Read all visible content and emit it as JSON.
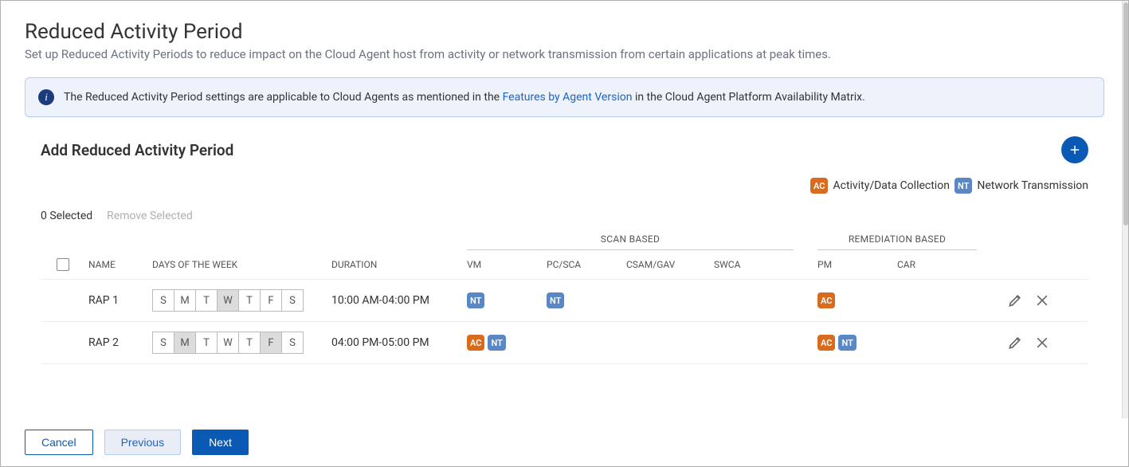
{
  "header": {
    "title": "Reduced Activity Period",
    "subtitle": "Set up Reduced Activity Periods to reduce impact on the Cloud Agent host from activity or network transmission from certain applications at peak times."
  },
  "banner": {
    "prefix": "The Reduced Activity Period settings are applicable to Cloud Agents as mentioned in the ",
    "link": "Features by Agent Version",
    "suffix": " in the Cloud Agent Platform Availability Matrix."
  },
  "section": {
    "heading": "Add Reduced Activity Period"
  },
  "legend": {
    "ac_code": "AC",
    "ac_label": "Activity/Data Collection",
    "nt_code": "NT",
    "nt_label": "Network Transmission"
  },
  "selection": {
    "count_label": "0 Selected",
    "remove_label": "Remove Selected"
  },
  "table": {
    "group_headers": {
      "scan": "SCAN BASED",
      "remediation": "REMEDIATION BASED"
    },
    "columns": {
      "name": "NAME",
      "days": "DAYS OF THE WEEK",
      "duration": "DURATION",
      "vm": "VM",
      "pcsca": "PC/SCA",
      "csam": "CSAM/GAV",
      "swca": "SWCA",
      "pm": "PM",
      "car": "CAR"
    },
    "day_letters": [
      "S",
      "M",
      "T",
      "W",
      "T",
      "F",
      "S"
    ],
    "rows": [
      {
        "name": "RAP 1",
        "days_selected": [
          false,
          false,
          false,
          true,
          false,
          false,
          false
        ],
        "duration": "10:00 AM-04:00 PM",
        "vm": [
          "NT"
        ],
        "pcsca": [
          "NT"
        ],
        "csam": [],
        "swca": [],
        "pm": [
          "AC"
        ],
        "car": []
      },
      {
        "name": "RAP 2",
        "days_selected": [
          false,
          true,
          false,
          false,
          false,
          true,
          false
        ],
        "duration": "04:00 PM-05:00 PM",
        "vm": [
          "AC",
          "NT"
        ],
        "pcsca": [],
        "csam": [],
        "swca": [],
        "pm": [
          "AC",
          "NT"
        ],
        "car": []
      }
    ]
  },
  "footer": {
    "cancel": "Cancel",
    "previous": "Previous",
    "next": "Next"
  }
}
